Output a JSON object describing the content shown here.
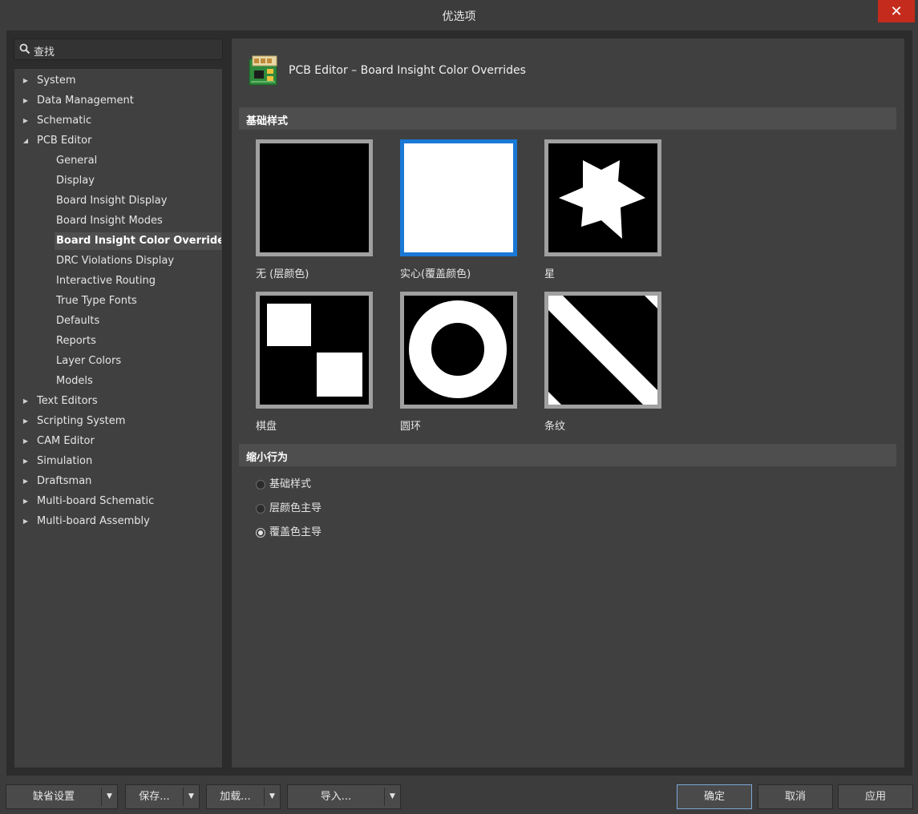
{
  "window": {
    "title": "优选项",
    "close_glyph": "✕"
  },
  "search": {
    "placeholder": "查找",
    "icon": "search-icon"
  },
  "tree": {
    "items": [
      {
        "label": "System",
        "level": 0,
        "expanded": false
      },
      {
        "label": "Data Management",
        "level": 0,
        "expanded": false
      },
      {
        "label": "Schematic",
        "level": 0,
        "expanded": false
      },
      {
        "label": "PCB Editor",
        "level": 0,
        "expanded": true
      },
      {
        "label": "General",
        "level": 1
      },
      {
        "label": "Display",
        "level": 1
      },
      {
        "label": "Board Insight Display",
        "level": 1
      },
      {
        "label": "Board Insight Modes",
        "level": 1
      },
      {
        "label": "Board Insight Color Overrides",
        "level": 1,
        "selected": true
      },
      {
        "label": "DRC Violations Display",
        "level": 1
      },
      {
        "label": "Interactive Routing",
        "level": 1
      },
      {
        "label": "True Type Fonts",
        "level": 1
      },
      {
        "label": "Defaults",
        "level": 1
      },
      {
        "label": "Reports",
        "level": 1
      },
      {
        "label": "Layer Colors",
        "level": 1
      },
      {
        "label": "Models",
        "level": 1
      },
      {
        "label": "Text Editors",
        "level": 0,
        "expanded": false
      },
      {
        "label": "Scripting System",
        "level": 0,
        "expanded": false
      },
      {
        "label": "CAM Editor",
        "level": 0,
        "expanded": false
      },
      {
        "label": "Simulation",
        "level": 0,
        "expanded": false
      },
      {
        "label": "Draftsman",
        "level": 0,
        "expanded": false
      },
      {
        "label": "Multi-board Schematic",
        "level": 0,
        "expanded": false
      },
      {
        "label": "Multi-board Assembly",
        "level": 0,
        "expanded": false
      }
    ]
  },
  "page": {
    "title": "PCB Editor – Board Insight Color Overrides",
    "icon": "pcb-board-icon"
  },
  "base_pattern": {
    "heading": "基础样式",
    "options": [
      {
        "label": "无 (层颜色)",
        "pattern": "none",
        "selected": false
      },
      {
        "label": "实心(覆盖颜色)",
        "pattern": "solid",
        "selected": true
      },
      {
        "label": "星",
        "pattern": "star",
        "selected": false
      },
      {
        "label": "棋盘",
        "pattern": "checkerboard",
        "selected": false
      },
      {
        "label": "圆环",
        "pattern": "circle",
        "selected": false
      },
      {
        "label": "条纹",
        "pattern": "stripe",
        "selected": false
      }
    ]
  },
  "zoom_out_behavior": {
    "heading": "缩小行为",
    "options": [
      {
        "label": "基础样式",
        "checked": false
      },
      {
        "label": "层颜色主导",
        "checked": false
      },
      {
        "label": "覆盖色主导",
        "checked": true
      }
    ]
  },
  "buttons": {
    "defaults": "缺省设置",
    "save": "保存...",
    "load": "加载...",
    "import": "导入...",
    "ok": "确定",
    "cancel": "取消",
    "apply": "应用",
    "dropdown_glyph": "▼"
  },
  "colors": {
    "selection_blue": "#1a78d6",
    "close_red": "#c42b1c"
  }
}
